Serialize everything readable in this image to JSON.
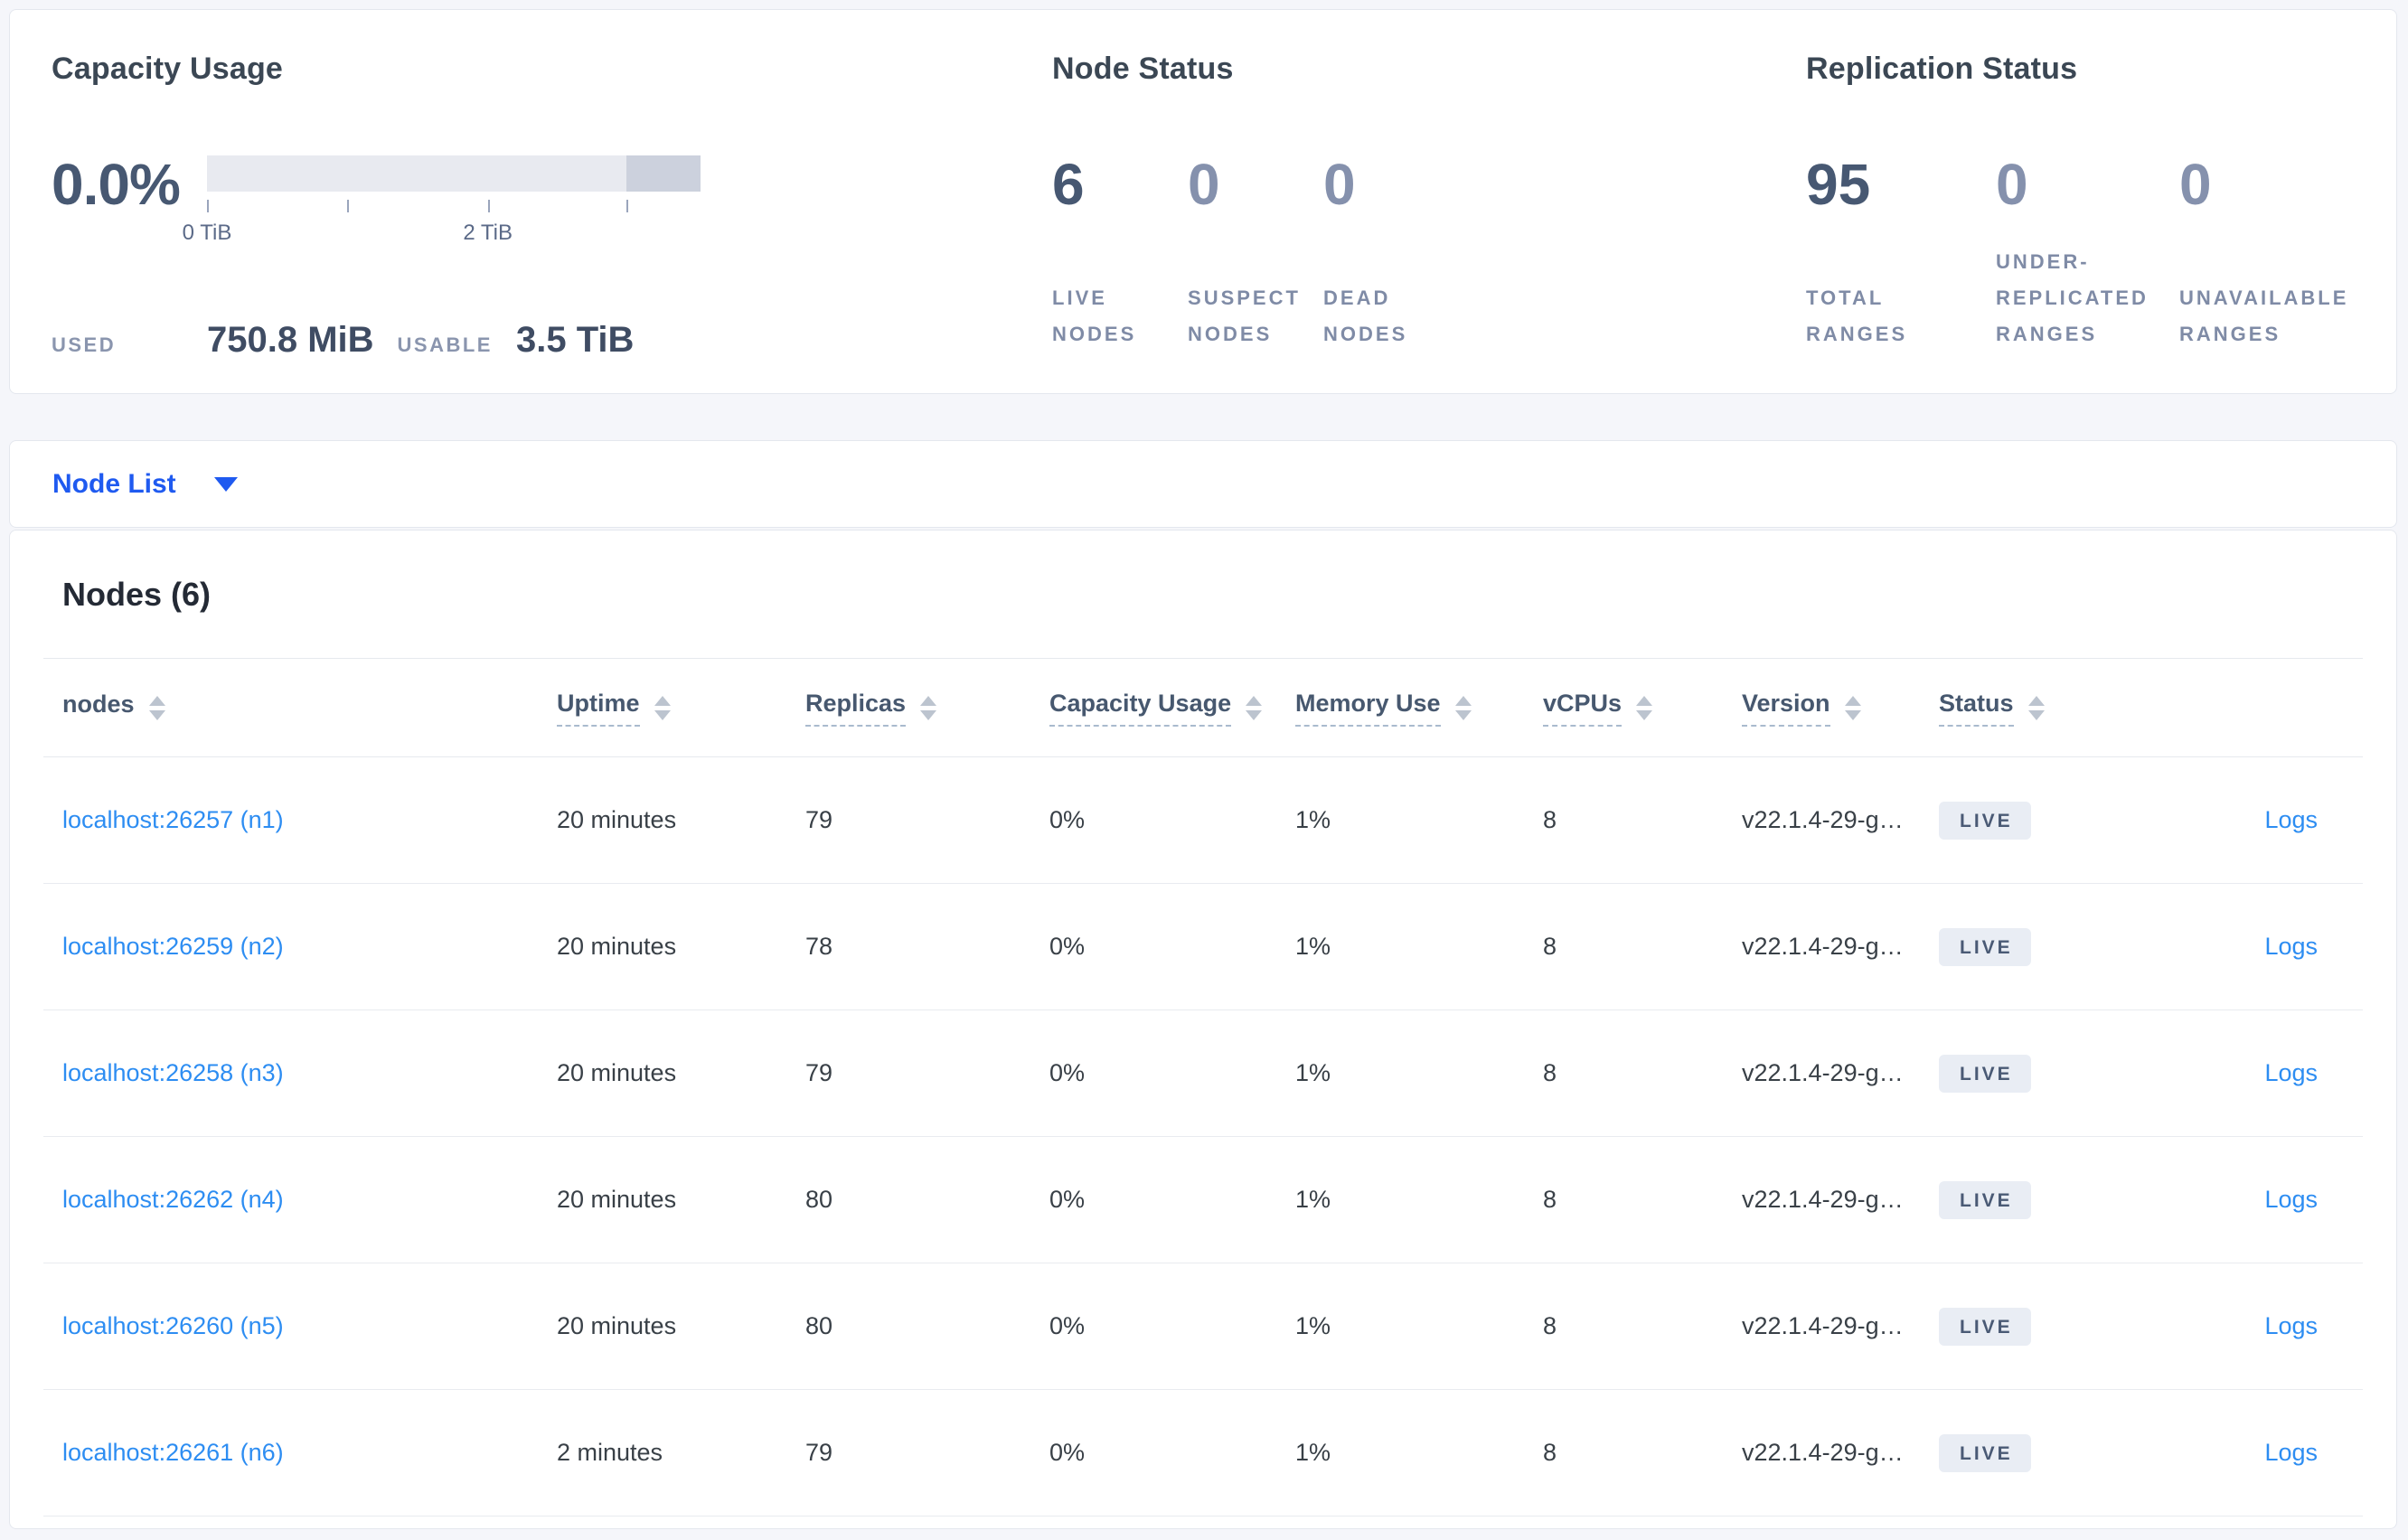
{
  "summary": {
    "capacity": {
      "title": "Capacity Usage",
      "percent": "0.0%",
      "bar": {
        "track_width": "85%",
        "tail_width": "15%"
      },
      "tick_labels": [
        "0 TiB",
        "2 TiB"
      ],
      "used_label": "USED",
      "used_value": "750.8 MiB",
      "usable_label": "USABLE",
      "usable_value": "3.5 TiB"
    },
    "node_status": {
      "title": "Node Status",
      "stats": [
        {
          "value": "6",
          "label": "LIVE NODES"
        },
        {
          "value": "0",
          "label": "SUSPECT NODES"
        },
        {
          "value": "0",
          "label": "DEAD NODES"
        }
      ]
    },
    "replication": {
      "title": "Replication Status",
      "stats": [
        {
          "value": "95",
          "label": "TOTAL RANGES"
        },
        {
          "value": "0",
          "label": "UNDER-REPLICATED RANGES"
        },
        {
          "value": "0",
          "label": "UNAVAILABLE RANGES"
        }
      ]
    }
  },
  "view_selector": {
    "label": "Node List",
    "caret_icon": "caret-down"
  },
  "nodes_table": {
    "heading": "Nodes (6)",
    "columns": [
      {
        "label": "nodes"
      },
      {
        "label": "Uptime"
      },
      {
        "label": "Replicas"
      },
      {
        "label": "Capacity Usage"
      },
      {
        "label": "Memory Use"
      },
      {
        "label": "vCPUs"
      },
      {
        "label": "Version"
      },
      {
        "label": "Status"
      }
    ],
    "rows": [
      {
        "node": "localhost:26257 (n1)",
        "uptime": "20 minutes",
        "replicas": "79",
        "capacity": "0%",
        "memory": "1%",
        "vcpus": "8",
        "version": "v22.1.4-29-g…",
        "status": "LIVE",
        "logs": "Logs"
      },
      {
        "node": "localhost:26259 (n2)",
        "uptime": "20 minutes",
        "replicas": "78",
        "capacity": "0%",
        "memory": "1%",
        "vcpus": "8",
        "version": "v22.1.4-29-g…",
        "status": "LIVE",
        "logs": "Logs"
      },
      {
        "node": "localhost:26258 (n3)",
        "uptime": "20 minutes",
        "replicas": "79",
        "capacity": "0%",
        "memory": "1%",
        "vcpus": "8",
        "version": "v22.1.4-29-g…",
        "status": "LIVE",
        "logs": "Logs"
      },
      {
        "node": "localhost:26262 (n4)",
        "uptime": "20 minutes",
        "replicas": "80",
        "capacity": "0%",
        "memory": "1%",
        "vcpus": "8",
        "version": "v22.1.4-29-g…",
        "status": "LIVE",
        "logs": "Logs"
      },
      {
        "node": "localhost:26260 (n5)",
        "uptime": "20 minutes",
        "replicas": "80",
        "capacity": "0%",
        "memory": "1%",
        "vcpus": "8",
        "version": "v22.1.4-29-g…",
        "status": "LIVE",
        "logs": "Logs"
      },
      {
        "node": "localhost:26261 (n6)",
        "uptime": "2 minutes",
        "replicas": "79",
        "capacity": "0%",
        "memory": "1%",
        "vcpus": "8",
        "version": "v22.1.4-29-g…",
        "status": "LIVE",
        "logs": "Logs"
      }
    ]
  },
  "colors": {
    "accent_blue": "#1f5af0",
    "link_blue": "#2d8df2",
    "emphasis_slate": "#475872",
    "muted_slate": "#8591ad",
    "badge_bg": "#e9edf4"
  }
}
